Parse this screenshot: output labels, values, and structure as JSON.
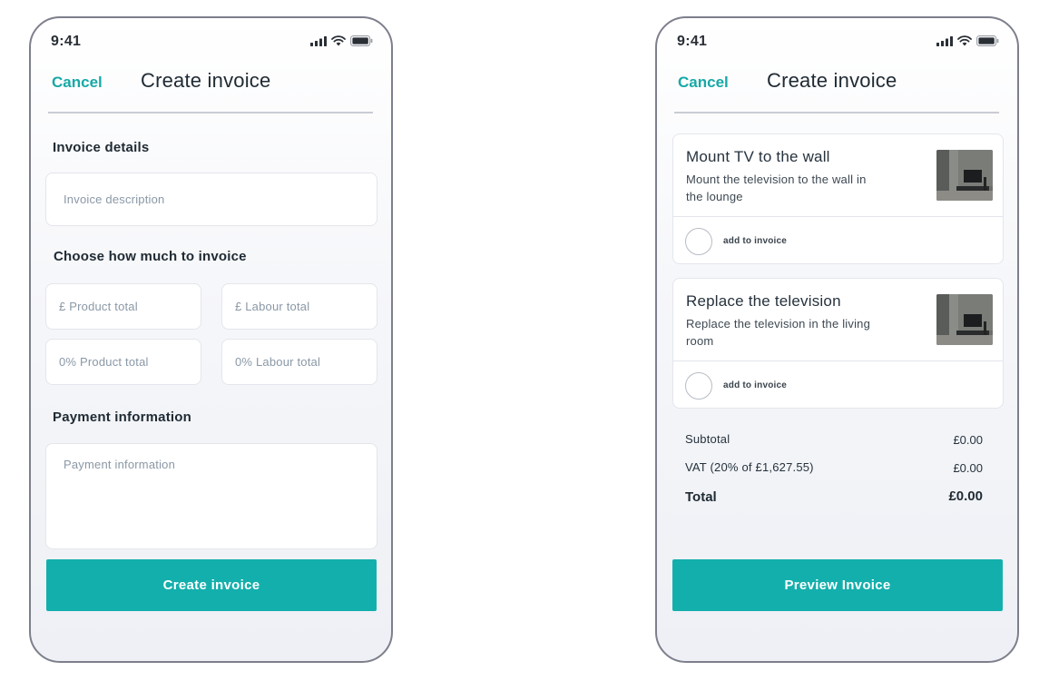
{
  "status_bar": {
    "time": "9:41"
  },
  "left_screen": {
    "cancel_label": "Cancel",
    "title": "Create invoice",
    "invoice_details_heading": "Invoice details",
    "invoice_description_placeholder": "Invoice description",
    "choose_amount_heading": "Choose how much to invoice",
    "product_total_placeholder": "£  Product total",
    "labour_total_placeholder": "£  Labour total",
    "product_percent_placeholder": "0% Product total",
    "labour_percent_placeholder": "0% Labour total",
    "payment_heading": "Payment information",
    "payment_placeholder": "Payment information",
    "submit_label": "Create invoice"
  },
  "right_screen": {
    "cancel_label": "Cancel",
    "title": "Create invoice",
    "jobs": [
      {
        "title": "Mount TV to the wall",
        "description": "Mount the television to the wall in the lounge",
        "add_label": "add to invoice",
        "thumbnail": "tv-room-photo"
      },
      {
        "title": "Replace the television",
        "description": "Replace the television in the living room",
        "add_label": "add to invoice",
        "thumbnail": "tv-room-photo"
      }
    ],
    "summary": {
      "subtotal_label": "Subtotal",
      "subtotal_value": "£0.00",
      "vat_label": "VAT (20% of £1,627.55)",
      "vat_value": "£0.00",
      "total_label": "Total",
      "total_value": "£0.00"
    },
    "submit_label": "Preview Invoice"
  },
  "colors": {
    "accent": "#13afac",
    "cancel": "#17a9a6",
    "frame": "#7d7f8c"
  },
  "icons": [
    "signal-icon",
    "wifi-icon",
    "battery-icon",
    "tv-room-photo"
  ]
}
